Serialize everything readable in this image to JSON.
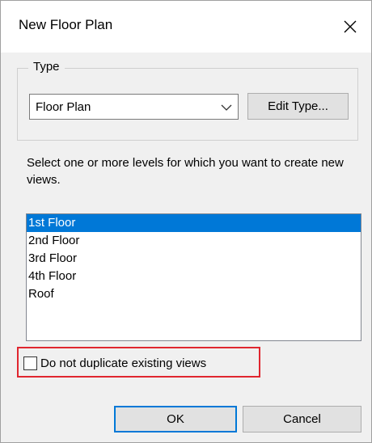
{
  "dialog": {
    "title": "New Floor Plan",
    "close_icon": "close-icon"
  },
  "type_group": {
    "label": "Type",
    "selected_type": "Floor Plan",
    "dropdown_icon": "chevron-down-icon",
    "edit_type_label": "Edit Type..."
  },
  "levels": {
    "instructions": "Select one or more levels for which you want to create new views.",
    "items": [
      {
        "label": "1st Floor",
        "selected": true
      },
      {
        "label": "2nd Floor",
        "selected": false
      },
      {
        "label": "3rd Floor",
        "selected": false
      },
      {
        "label": "4th Floor",
        "selected": false
      },
      {
        "label": "Roof",
        "selected": false
      }
    ]
  },
  "options": {
    "no_duplicate_label": "Do not duplicate existing views",
    "no_duplicate_checked": false
  },
  "footer": {
    "ok_label": "OK",
    "cancel_label": "Cancel"
  },
  "colors": {
    "selection": "#0078d7",
    "highlight_outline": "#e0262f",
    "default_button_border": "#0078d7"
  }
}
